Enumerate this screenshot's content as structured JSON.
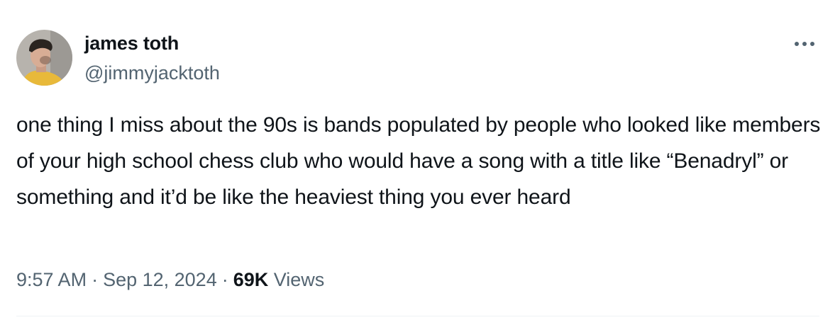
{
  "author": {
    "display_name": "james toth",
    "handle": "@jimmyjacktoth",
    "avatar_icon": "profile-photo"
  },
  "more_icon": "more-horizontal-icon",
  "tweet": {
    "text": "one thing I miss about the 90s is bands populated by people who looked like members of your high school chess club who would have a song with a title like “Benadryl” or something and it’d be like the heaviest thing you ever heard"
  },
  "meta": {
    "time": "9:57 AM",
    "separator": "·",
    "date": "Sep 12, 2024",
    "views_count": "69K",
    "views_label": "Views"
  },
  "colors": {
    "text_primary": "#0f1419",
    "text_secondary": "#536471",
    "divider": "#eff3f4",
    "avatar_shirt": "#e8b93a"
  }
}
